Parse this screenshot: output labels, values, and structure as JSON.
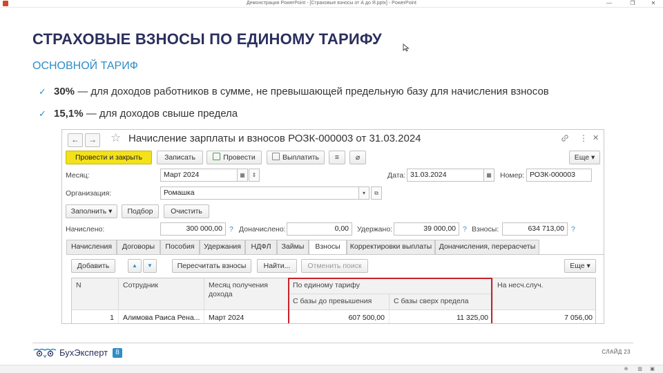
{
  "window": {
    "title": "Демонстрация PowerPoint - [Страховые взносы от А до Я.pptx] - PowerPoint",
    "minimize": "—",
    "restore": "❐",
    "close": "✕"
  },
  "slide": {
    "title": "СТРАХОВЫЕ ВЗНОСЫ ПО ЕДИНОМУ ТАРИФУ",
    "subtitle": "ОСНОВНОЙ ТАРИФ",
    "bullets": [
      {
        "bold": "30%",
        "text": " — для доходов работников в сумме, не превышающей предельную базу для начисления взносов"
      },
      {
        "bold": "15,1%",
        "text": " — для доходов свыше предела"
      }
    ],
    "check_icon": "✓"
  },
  "form": {
    "nav_back": "←",
    "nav_forward": "→",
    "star_icon": "☆",
    "title": "Начисление зарплаты и взносов РОЗК-000003 от 31.03.2024",
    "link_icon": "🔗",
    "more_icon": "⋮",
    "close_icon": "✕",
    "toolbar": {
      "post_close": "Провести и закрыть",
      "save": "Записать",
      "post": "Провести",
      "pay": "Выплатить",
      "more": "Еще ▾"
    },
    "fields": {
      "month_label": "Месяц:",
      "month_value": "Март 2024",
      "date_label": "Дата:",
      "date_value": "31.03.2024",
      "number_label": "Номер:",
      "number_value": "РОЗК-000003",
      "org_label": "Организация:",
      "org_value": "Ромашка"
    },
    "actions": {
      "fill": "Заполнить ▾",
      "select": "Подбор",
      "clear": "Очистить"
    },
    "totals": {
      "accrued_label": "Начислено:",
      "accrued_value": "300 000,00",
      "additional_label": "Доначислено:",
      "additional_value": "0,00",
      "withheld_label": "Удержано:",
      "withheld_value": "39 000,00",
      "contrib_label": "Взносы:",
      "contrib_value": "634 713,00",
      "q": "?"
    },
    "tabs": [
      "Начисления",
      "Договоры",
      "Пособия",
      "Удержания",
      "НДФЛ",
      "Займы",
      "Взносы",
      "Корректировки выплаты",
      "Доначисления, перерасчеты"
    ],
    "active_tab": "Взносы",
    "tab_toolbar": {
      "add": "Добавить",
      "up": "▲",
      "down": "▼",
      "recalc": "Пересчитать взносы",
      "find": "Найти...",
      "cancel_search": "Отменить поиск",
      "more": "Еще ▾"
    },
    "table": {
      "headers": {
        "n": "N",
        "employee": "Сотрудник",
        "month": "Месяц получения дохода",
        "unified": "По единому тарифу",
        "below": "С базы до превышения",
        "above": "С базы сверх предела",
        "accident": "На несч.случ."
      },
      "rows": [
        {
          "n": "1",
          "employee": "Алимова Раиса Рена...",
          "month": "Март 2024",
          "below": "607 500,00",
          "above": "11 325,00",
          "accident": "7 056,00"
        }
      ]
    }
  },
  "footer": {
    "logo_text": "БухЭксперт",
    "logo_badge": "8",
    "slide_number": "СЛАЙД 23"
  },
  "colors": {
    "title": "#2b2f5d",
    "accent": "#2d8dc8",
    "primary_button": "#f3e11a",
    "highlight_box": "#c8202a"
  }
}
